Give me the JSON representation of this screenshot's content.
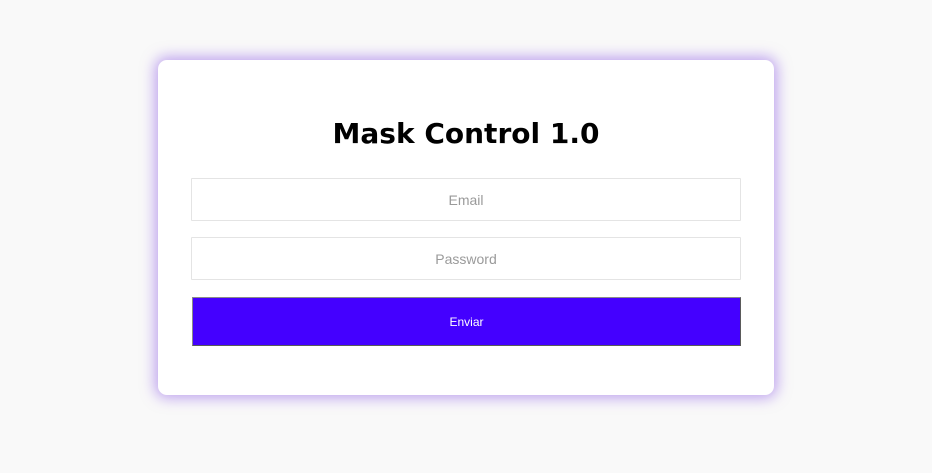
{
  "login": {
    "title": "Mask Control 1.0",
    "email_placeholder": "Email",
    "email_value": "",
    "password_placeholder": "Password",
    "password_value": "",
    "submit_label": "Enviar"
  },
  "colors": {
    "background": "#f9f9f9",
    "card": "#ffffff",
    "card_glow": "#8c5ae6",
    "button": "#4400ff",
    "button_text": "#ffffff"
  }
}
